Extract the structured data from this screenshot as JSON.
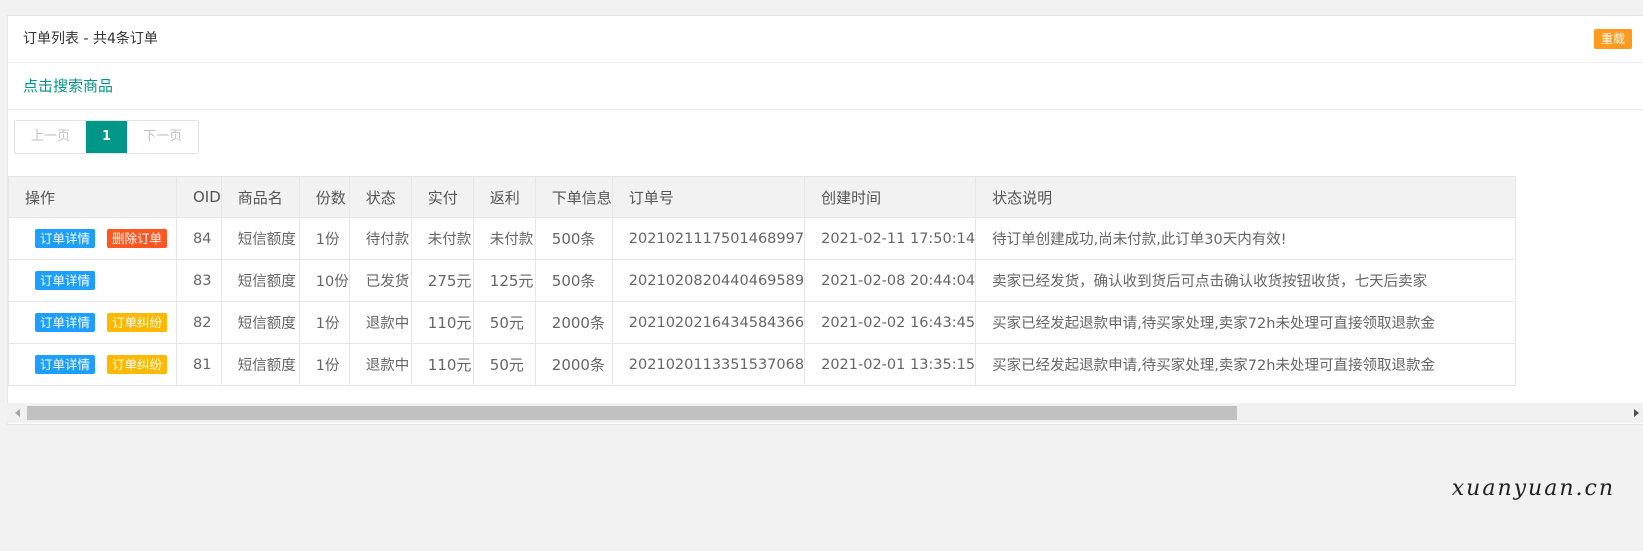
{
  "panel": {
    "title": "订单列表 - 共4条订单",
    "reload_label": "重载"
  },
  "search": {
    "link_label": "点击搜索商品"
  },
  "pagination": {
    "prev_label": "上一页",
    "current_page": "1",
    "next_label": "下一页"
  },
  "table": {
    "headers": [
      "操作",
      "OID",
      "商品名",
      "份数",
      "状态",
      "实付",
      "返利",
      "下单信息",
      "订单号",
      "创建时间",
      "状态说明"
    ],
    "rows": [
      {
        "actions": [
          {
            "label": "订单详情",
            "color": "blue"
          },
          {
            "label": "删除订单",
            "color": "red"
          }
        ],
        "oid": "84",
        "product": "短信额度",
        "qty": "1份",
        "status": "待付款",
        "paid": "未付款",
        "rebate": "未付款",
        "info": "500条",
        "order_no": "2021021117501468997",
        "created": "2021-02-11 17:50:14",
        "desc": "待订单创建成功,尚未付款,此订单30天内有效!"
      },
      {
        "actions": [
          {
            "label": "订单详情",
            "color": "blue"
          }
        ],
        "oid": "83",
        "product": "短信额度",
        "qty": "10份",
        "status": "已发货",
        "paid": "275元",
        "rebate": "125元",
        "info": "500条",
        "order_no": "2021020820440469589",
        "created": "2021-02-08 20:44:04",
        "desc": "卖家已经发货，确认收到货后可点击确认收货按钮收货，七天后卖家"
      },
      {
        "actions": [
          {
            "label": "订单详情",
            "color": "blue"
          },
          {
            "label": "订单纠纷",
            "color": "yellow"
          }
        ],
        "oid": "82",
        "product": "短信额度",
        "qty": "1份",
        "status": "退款中",
        "paid": "110元",
        "rebate": "50元",
        "info": "2000条",
        "order_no": "2021020216434584366",
        "created": "2021-02-02 16:43:45",
        "desc": "买家已经发起退款申请,待买家处理,卖家72h未处理可直接领取退款金"
      },
      {
        "actions": [
          {
            "label": "订单详情",
            "color": "blue"
          },
          {
            "label": "订单纠纷",
            "color": "yellow"
          }
        ],
        "oid": "81",
        "product": "短信额度",
        "qty": "1份",
        "status": "退款中",
        "paid": "110元",
        "rebate": "50元",
        "info": "2000条",
        "order_no": "2021020113351537068",
        "created": "2021-02-01 13:35:15",
        "desc": "买家已经发起退款申请,待买家处理,卖家72h未处理可直接领取退款金"
      }
    ]
  },
  "watermark": "xuanyuan.cn",
  "colors": {
    "accent": "#009688",
    "reload": "#ff9a1e",
    "tag_blue": "#1e9fff",
    "tag_red": "#ff5722",
    "tag_yellow": "#ffb800"
  }
}
